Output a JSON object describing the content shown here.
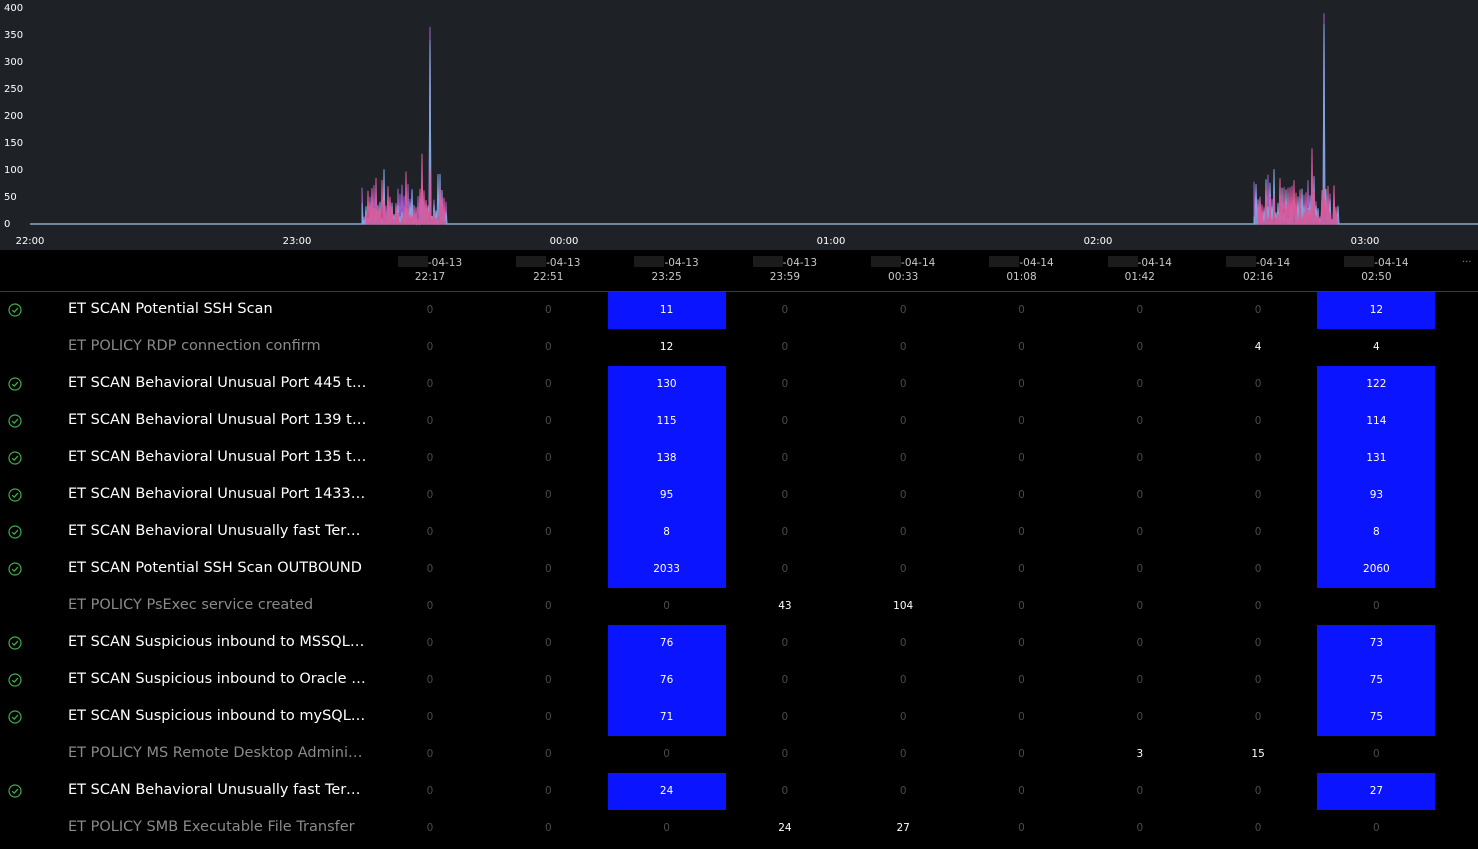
{
  "chart": {
    "y_ticks": [
      "400",
      "350",
      "300",
      "250",
      "200",
      "150",
      "100",
      "50",
      "0"
    ],
    "x_ticks": [
      "22:00",
      "23:00",
      "00:00",
      "01:00",
      "02:00",
      "03:00"
    ],
    "axis_color": "#8aa7c8",
    "colors": {
      "series_a": "#7ea6e0",
      "series_b": "#d9599a",
      "series_c": "#a05cc8",
      "series_d": "#e89a3c"
    }
  },
  "columns": [
    {
      "date": "-04-13",
      "time": "22:17"
    },
    {
      "date": "-04-13",
      "time": "22:51"
    },
    {
      "date": "-04-13",
      "time": "23:25"
    },
    {
      "date": "-04-13",
      "time": "23:59"
    },
    {
      "date": "-04-14",
      "time": "00:33"
    },
    {
      "date": "-04-14",
      "time": "01:08"
    },
    {
      "date": "-04-14",
      "time": "01:42"
    },
    {
      "date": "-04-14",
      "time": "02:16"
    },
    {
      "date": "-04-14",
      "time": "02:50"
    }
  ],
  "more_columns": "...",
  "rows": [
    {
      "label": "ET SCAN Potential SSH Scan",
      "active": true,
      "values": [
        "0",
        "0",
        "11",
        "0",
        "0",
        "0",
        "0",
        "0",
        "12"
      ],
      "hot": [
        2,
        8
      ]
    },
    {
      "label": "ET POLICY RDP connection confirm",
      "active": false,
      "values": [
        "0",
        "0",
        "12",
        "0",
        "0",
        "0",
        "0",
        "4",
        "4"
      ],
      "hot": []
    },
    {
      "label": "ET SCAN Behavioral Unusual Port 445 tr…",
      "active": true,
      "values": [
        "0",
        "0",
        "130",
        "0",
        "0",
        "0",
        "0",
        "0",
        "122"
      ],
      "hot": [
        2,
        8
      ]
    },
    {
      "label": "ET SCAN Behavioral Unusual Port 139 tr…",
      "active": true,
      "values": [
        "0",
        "0",
        "115",
        "0",
        "0",
        "0",
        "0",
        "0",
        "114"
      ],
      "hot": [
        2,
        8
      ]
    },
    {
      "label": "ET SCAN Behavioral Unusual Port 135 tr…",
      "active": true,
      "values": [
        "0",
        "0",
        "138",
        "0",
        "0",
        "0",
        "0",
        "0",
        "131"
      ],
      "hot": [
        2,
        8
      ]
    },
    {
      "label": "ET SCAN Behavioral Unusual Port 1433 t…",
      "active": true,
      "values": [
        "0",
        "0",
        "95",
        "0",
        "0",
        "0",
        "0",
        "0",
        "93"
      ],
      "hot": [
        2,
        8
      ]
    },
    {
      "label": "ET SCAN Behavioral Unusually fast Termi…",
      "active": true,
      "values": [
        "0",
        "0",
        "8",
        "0",
        "0",
        "0",
        "0",
        "0",
        "8"
      ],
      "hot": [
        2,
        8
      ]
    },
    {
      "label": "ET SCAN Potential SSH Scan OUTBOUND",
      "active": true,
      "values": [
        "0",
        "0",
        "2033",
        "0",
        "0",
        "0",
        "0",
        "0",
        "2060"
      ],
      "hot": [
        2,
        8
      ]
    },
    {
      "label": "ET POLICY PsExec service created",
      "active": false,
      "values": [
        "0",
        "0",
        "0",
        "43",
        "104",
        "0",
        "0",
        "0",
        "0"
      ],
      "hot": []
    },
    {
      "label": "ET SCAN Suspicious inbound to MSSQL p…",
      "active": true,
      "values": [
        "0",
        "0",
        "76",
        "0",
        "0",
        "0",
        "0",
        "0",
        "73"
      ],
      "hot": [
        2,
        8
      ]
    },
    {
      "label": "ET SCAN Suspicious inbound to Oracle S…",
      "active": true,
      "values": [
        "0",
        "0",
        "76",
        "0",
        "0",
        "0",
        "0",
        "0",
        "75"
      ],
      "hot": [
        2,
        8
      ]
    },
    {
      "label": "ET SCAN Suspicious inbound to mySQL …",
      "active": true,
      "values": [
        "0",
        "0",
        "71",
        "0",
        "0",
        "0",
        "0",
        "0",
        "75"
      ],
      "hot": [
        2,
        8
      ]
    },
    {
      "label": "ET POLICY MS Remote Desktop Administ…",
      "active": false,
      "values": [
        "0",
        "0",
        "0",
        "0",
        "0",
        "0",
        "3",
        "15",
        "0"
      ],
      "hot": []
    },
    {
      "label": "ET SCAN Behavioral Unusually fast Termi…",
      "active": true,
      "values": [
        "0",
        "0",
        "24",
        "0",
        "0",
        "0",
        "0",
        "0",
        "27"
      ],
      "hot": [
        2,
        8
      ]
    },
    {
      "label": "ET POLICY SMB Executable File Transfer",
      "active": false,
      "values": [
        "0",
        "0",
        "0",
        "24",
        "27",
        "0",
        "0",
        "0",
        "0"
      ],
      "hot": []
    }
  ],
  "status_icon": "check-circle-icon",
  "status_icon_color": "#3fae49"
}
